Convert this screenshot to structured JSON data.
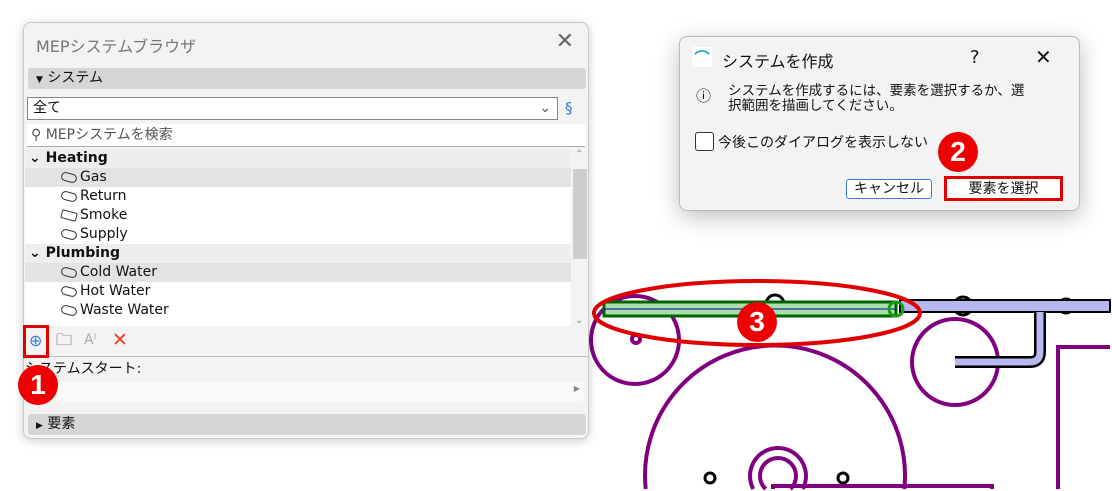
{
  "panel": {
    "title": "MEPシステムブラウザ",
    "section_system": "システム",
    "filter_value": "全て",
    "search_placeholder": "MEPシステムを検索",
    "tree": [
      {
        "group": "Heating",
        "items": [
          "Gas",
          "Return",
          "Smoke",
          "Supply"
        ]
      },
      {
        "group": "Plumbing",
        "items": [
          "Cold Water",
          "Hot Water",
          "Waste Water"
        ]
      }
    ],
    "system_start_label": "システムスタート:",
    "section_elements": "要素"
  },
  "dialog": {
    "title": "システムを作成",
    "help": "?",
    "message_line1": "システムを作成するには、要素を選択するか、選",
    "message_line2": "択範囲を描画してください。",
    "checkbox_label": "今後このダイアログを表示しない",
    "cancel_label": "キャンセル",
    "select_label": "要素を選択"
  },
  "annotations": {
    "step1": "1",
    "step2": "2",
    "step3": "3"
  },
  "colors": {
    "annotation": "#e00000",
    "pipe_selected": "#2e8b2e",
    "pipe_other": "#b8b8f0",
    "equipment": "#800080"
  }
}
